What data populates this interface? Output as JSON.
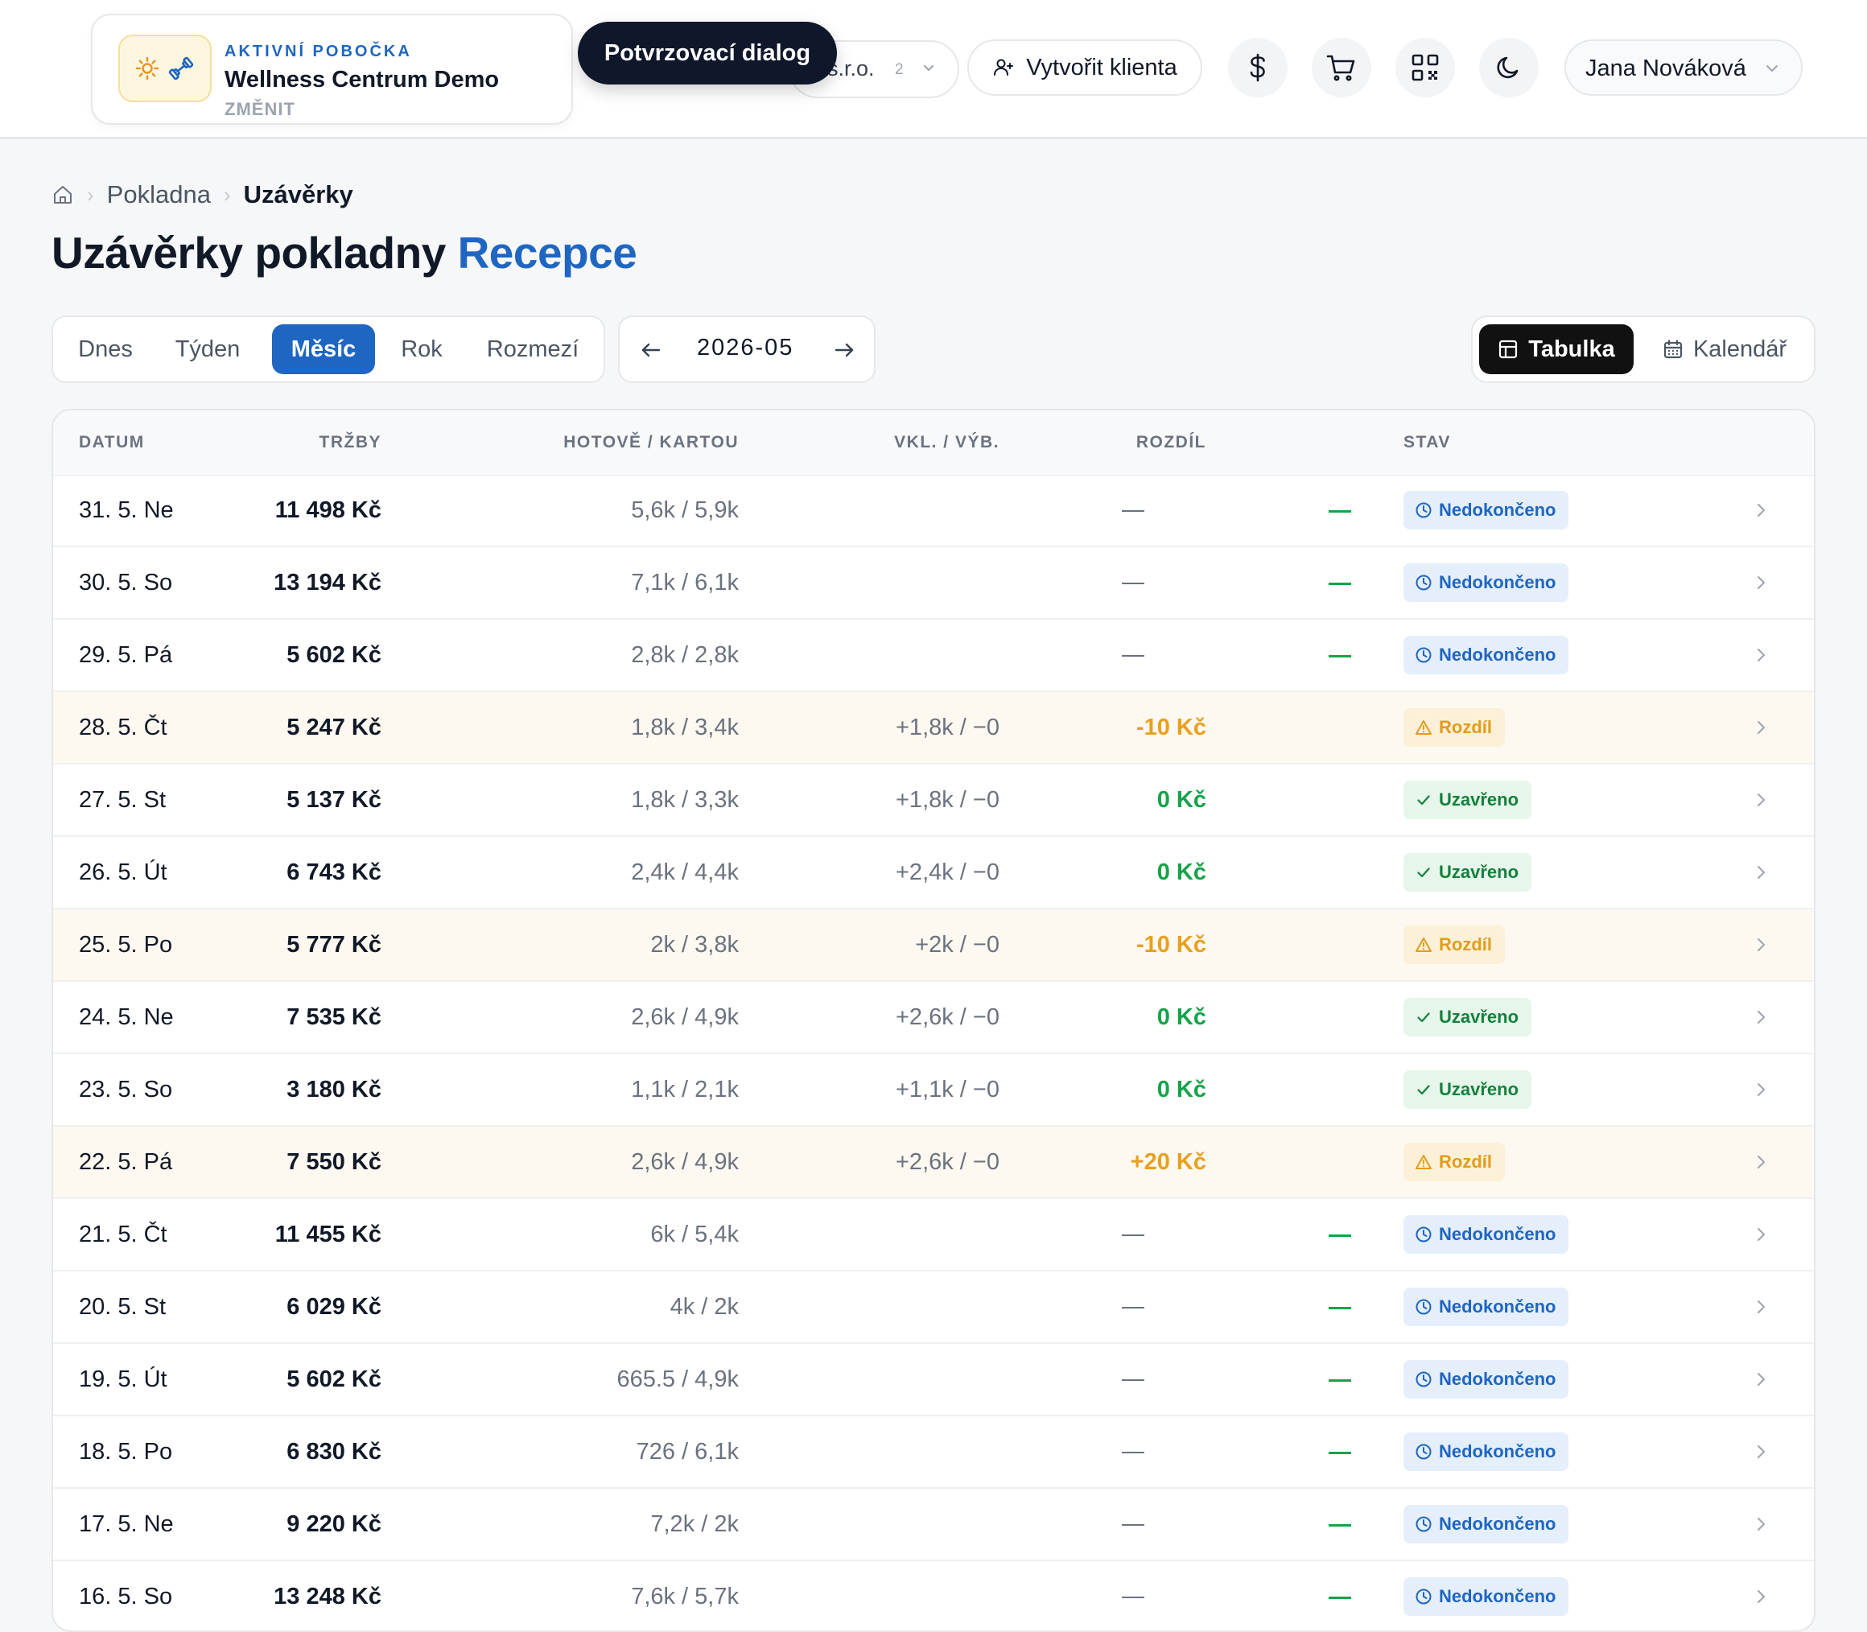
{
  "header": {
    "branch_kicker": "AKTIVNÍ POBOČKA",
    "branch_name": "Wellness Centrum Demo",
    "branch_change": "ZMĚNIT",
    "company_label": "s.r.o.",
    "company_count": "2",
    "tooltip": "Potvrzovací dialog",
    "create_client": "Vytvořit klienta",
    "user_name": "Jana Nováková"
  },
  "breadcrumb": {
    "item1": "Pokladna",
    "current": "Uzávěrky"
  },
  "title": {
    "main": "Uzávěrky pokladny",
    "accent": "Recepce"
  },
  "filters": {
    "periods": [
      "Dnes",
      "Týden",
      "Měsíc",
      "Rok",
      "Rozmezí"
    ],
    "active_period": "Měsíc",
    "month": "2026-05",
    "views": {
      "table": "Tabulka",
      "calendar": "Kalendář"
    },
    "active_view": "Tabulka"
  },
  "table": {
    "headers": [
      "DATUM",
      "TRŽBY",
      "HOTOVĚ / KARTOU",
      "VKL. / VÝB.",
      "ROZDÍL",
      "STAV"
    ],
    "rows": [
      {
        "date": "31. 5. Ne",
        "revenue": "11 498 Kč",
        "cash_card": "5,6k / 5,9k",
        "dep_wd": "",
        "diff": "",
        "status": "Nedokončeno",
        "type": "open"
      },
      {
        "date": "30. 5. So",
        "revenue": "13 194 Kč",
        "cash_card": "7,1k / 6,1k",
        "dep_wd": "",
        "diff": "",
        "status": "Nedokončeno",
        "type": "open"
      },
      {
        "date": "29. 5. Pá",
        "revenue": "5 602 Kč",
        "cash_card": "2,8k / 2,8k",
        "dep_wd": "",
        "diff": "",
        "status": "Nedokončeno",
        "type": "open"
      },
      {
        "date": "28. 5. Čt",
        "revenue": "5 247 Kč",
        "cash_card": "1,8k / 3,4k",
        "dep_wd": "+1,8k / −0",
        "diff": "-10 Kč",
        "status": "Rozdíl",
        "type": "diff"
      },
      {
        "date": "27. 5. St",
        "revenue": "5 137 Kč",
        "cash_card": "1,8k / 3,3k",
        "dep_wd": "+1,8k / −0",
        "diff": "0 Kč",
        "status": "Uzavřeno",
        "type": "ok"
      },
      {
        "date": "26. 5. Út",
        "revenue": "6 743 Kč",
        "cash_card": "2,4k / 4,4k",
        "dep_wd": "+2,4k / −0",
        "diff": "0 Kč",
        "status": "Uzavřeno",
        "type": "ok"
      },
      {
        "date": "25. 5. Po",
        "revenue": "5 777 Kč",
        "cash_card": "2k / 3,8k",
        "dep_wd": "+2k / −0",
        "diff": "-10 Kč",
        "status": "Rozdíl",
        "type": "diff"
      },
      {
        "date": "24. 5. Ne",
        "revenue": "7 535 Kč",
        "cash_card": "2,6k / 4,9k",
        "dep_wd": "+2,6k / −0",
        "diff": "0 Kč",
        "status": "Uzavřeno",
        "type": "ok"
      },
      {
        "date": "23. 5. So",
        "revenue": "3 180 Kč",
        "cash_card": "1,1k / 2,1k",
        "dep_wd": "+1,1k / −0",
        "diff": "0 Kč",
        "status": "Uzavřeno",
        "type": "ok"
      },
      {
        "date": "22. 5. Pá",
        "revenue": "7 550 Kč",
        "cash_card": "2,6k / 4,9k",
        "dep_wd": "+2,6k / −0",
        "diff": "+20 Kč",
        "status": "Rozdíl",
        "type": "diff"
      },
      {
        "date": "21. 5. Čt",
        "revenue": "11 455 Kč",
        "cash_card": "6k / 5,4k",
        "dep_wd": "",
        "diff": "",
        "status": "Nedokončeno",
        "type": "open"
      },
      {
        "date": "20. 5. St",
        "revenue": "6 029 Kč",
        "cash_card": "4k / 2k",
        "dep_wd": "",
        "diff": "",
        "status": "Nedokončeno",
        "type": "open"
      },
      {
        "date": "19. 5. Út",
        "revenue": "5 602 Kč",
        "cash_card": "665.5 / 4,9k",
        "dep_wd": "",
        "diff": "",
        "status": "Nedokončeno",
        "type": "open"
      },
      {
        "date": "18. 5. Po",
        "revenue": "6 830 Kč",
        "cash_card": "726 / 6,1k",
        "dep_wd": "",
        "diff": "",
        "status": "Nedokončeno",
        "type": "open"
      },
      {
        "date": "17. 5. Ne",
        "revenue": "9 220 Kč",
        "cash_card": "7,2k / 2k",
        "dep_wd": "",
        "diff": "",
        "status": "Nedokončeno",
        "type": "open"
      },
      {
        "date": "16. 5. So",
        "revenue": "13 248 Kč",
        "cash_card": "7,6k / 5,7k",
        "dep_wd": "",
        "diff": "",
        "status": "Nedokončeno",
        "type": "open"
      }
    ]
  },
  "colors": {
    "accent": "#1e66c1",
    "ok": "#16a34a",
    "warning": "#e9a020",
    "dark": "#0f172a"
  }
}
